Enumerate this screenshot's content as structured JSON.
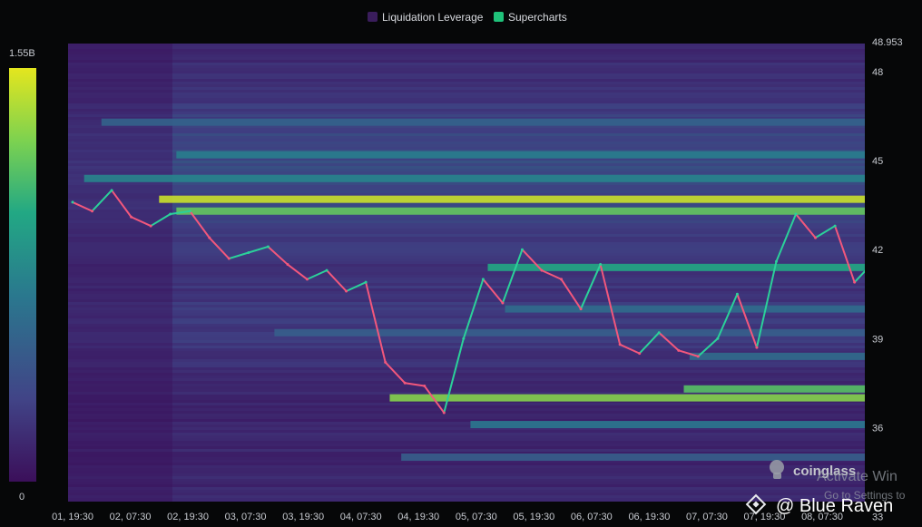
{
  "legend": [
    {
      "label": "Liquidation Leverage",
      "color": "#3a1d5c"
    },
    {
      "label": "Supercharts",
      "color": "#1fc27a"
    }
  ],
  "colorbar": {
    "max_label": "1.55B",
    "min_label": "0",
    "max": 1550000000,
    "min": 0,
    "colors": [
      "#3b0f5a",
      "#414487",
      "#2a788e",
      "#22a884",
      "#7ad151",
      "#e4e61e"
    ]
  },
  "watermark": {
    "brand": "coinglass",
    "brand_icon": "coinglass-logo",
    "author": "@ Blue Raven",
    "author_icon": "binance-diamond-icon",
    "os_overlay_line1": "Activate Win",
    "os_overlay_line2": "Go to Settings to"
  },
  "chart_data": {
    "type": "heatmap",
    "title": "",
    "xlabel": "",
    "ylabel": "",
    "y_axis_side": "right",
    "ylim": [
      33.5,
      48.953
    ],
    "y_top_label": "48.953",
    "y_ticks": [
      48,
      45,
      42,
      39,
      36,
      33
    ],
    "x_ticks": [
      "01, 19:30",
      "02, 07:30",
      "02, 19:30",
      "03, 07:30",
      "03, 19:30",
      "04, 07:30",
      "04, 19:30",
      "05, 07:30",
      "05, 19:30",
      "06, 07:30",
      "06, 19:30",
      "07, 07:30",
      "07, 19:30",
      "08, 07:30"
    ],
    "price_series": {
      "name": "Supercharts",
      "up_color": "#2bd19a",
      "down_color": "#f2577c",
      "x_points": [
        0,
        0.5,
        1,
        1.5,
        2,
        2.5,
        3,
        3.5,
        4,
        4.5,
        5,
        5.5,
        6,
        6.5,
        7,
        7.5,
        8,
        8.5,
        9,
        9.5,
        10,
        10.5,
        11,
        11.5,
        12,
        12.5,
        13,
        13.5,
        13.9
      ],
      "values": [
        43.6,
        43.3,
        44.0,
        43.1,
        42.8,
        43.2,
        43.3,
        42.4,
        41.7,
        41.9,
        42.1,
        41.5,
        41.0,
        41.3,
        40.6,
        40.9,
        38.2,
        37.5,
        37.4,
        36.5,
        39.0,
        41.0,
        40.2,
        42.0,
        41.3,
        41.0,
        40.0,
        41.5,
        38.8,
        38.5,
        39.2,
        38.6,
        38.4,
        39.0,
        40.5,
        38.7,
        41.6,
        43.2,
        42.4,
        42.8,
        40.9,
        41.6
      ]
    },
    "liquidation_bands": [
      {
        "price": 43.7,
        "x_start": 1.5,
        "intensity": 0.95
      },
      {
        "price": 43.3,
        "x_start": 1.8,
        "intensity": 0.75
      },
      {
        "price": 44.4,
        "x_start": 0.2,
        "intensity": 0.45
      },
      {
        "price": 45.2,
        "x_start": 1.8,
        "intensity": 0.42
      },
      {
        "price": 46.3,
        "x_start": 0.5,
        "intensity": 0.32
      },
      {
        "price": 37.3,
        "x_start": 10.6,
        "intensity": 0.72
      },
      {
        "price": 37.0,
        "x_start": 5.5,
        "intensity": 0.82
      },
      {
        "price": 36.1,
        "x_start": 6.9,
        "intensity": 0.4
      },
      {
        "price": 35.0,
        "x_start": 5.7,
        "intensity": 0.3
      },
      {
        "price": 41.4,
        "x_start": 7.2,
        "intensity": 0.6
      },
      {
        "price": 40.0,
        "x_start": 7.5,
        "intensity": 0.35
      },
      {
        "price": 39.2,
        "x_start": 3.5,
        "intensity": 0.3
      },
      {
        "price": 38.4,
        "x_start": 10.7,
        "intensity": 0.35
      }
    ]
  }
}
